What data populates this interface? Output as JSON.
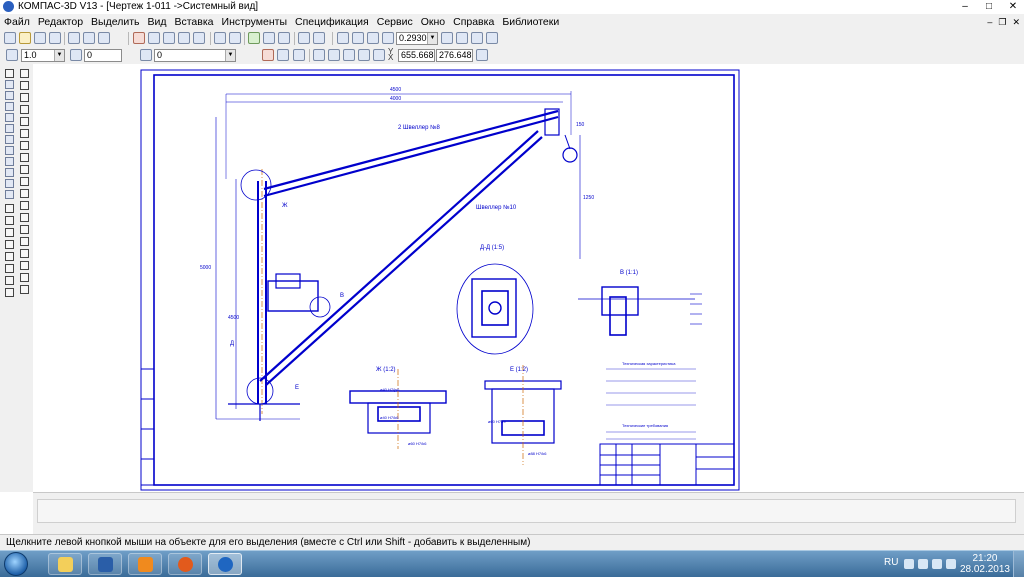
{
  "window": {
    "title": "КОМПАС-3D V13 - [Чертеж 1-011 ->Системный вид]",
    "minimize": "–",
    "maximize": "□",
    "close": "✕"
  },
  "menu": {
    "items": [
      "Файл",
      "Редактор",
      "Выделить",
      "Вид",
      "Вставка",
      "Инструменты",
      "Спецификация",
      "Сервис",
      "Окно",
      "Справка",
      "Библиотеки"
    ],
    "doc_minimize": "–",
    "doc_restore": "❐",
    "doc_close": "✕"
  },
  "toolbar1": {
    "zoom_value": "0.2930"
  },
  "toolbar2": {
    "step_value": "1.0",
    "layer_value": "0",
    "style_value": "0",
    "coord_x": "655.668",
    "coord_y": "276.648",
    "coord_label_x": "X",
    "coord_label_y": "Y"
  },
  "status": {
    "hint": "Щелкните левой кнопкой мыши на объекте для его выделения (вместе с Ctrl или Shift - добавить к выделенным)"
  },
  "taskbar": {
    "language": "RU",
    "time": "21:20",
    "date": "28.02.2013",
    "apps": [
      "explorer",
      "media-center",
      "media-player",
      "firefox",
      "kompas"
    ]
  },
  "drawing": {
    "frame_color": "#0000cc",
    "labels": {
      "channel_top": "2 Швеллер №8",
      "channel_diag": "Швеллер №10",
      "section_dd": "Д-Д (1:5)",
      "view_v": "В (1:1)",
      "view_zh": "Ж (1:2)",
      "view_e": "Е (1:2)",
      "mark_zh": "Ж",
      "mark_b": "В",
      "mark_e": "Е",
      "mark_d": "Д",
      "dim_top_1": "4500",
      "dim_top_2": "4000",
      "dim_right": "1250",
      "dim_left": "5000",
      "dim_left_2": "4500",
      "dim_small": "150",
      "fit_1": "ø40 H7/js6",
      "fit_2": "ø40 H7/k6",
      "fit_3": "ø60 H7/k6",
      "fit_4": "ø60 H7/f9",
      "fit_5": "ø88 H7/k6",
      "tech_title": "Техническая характеристика",
      "req_title": "Технические требования"
    }
  }
}
